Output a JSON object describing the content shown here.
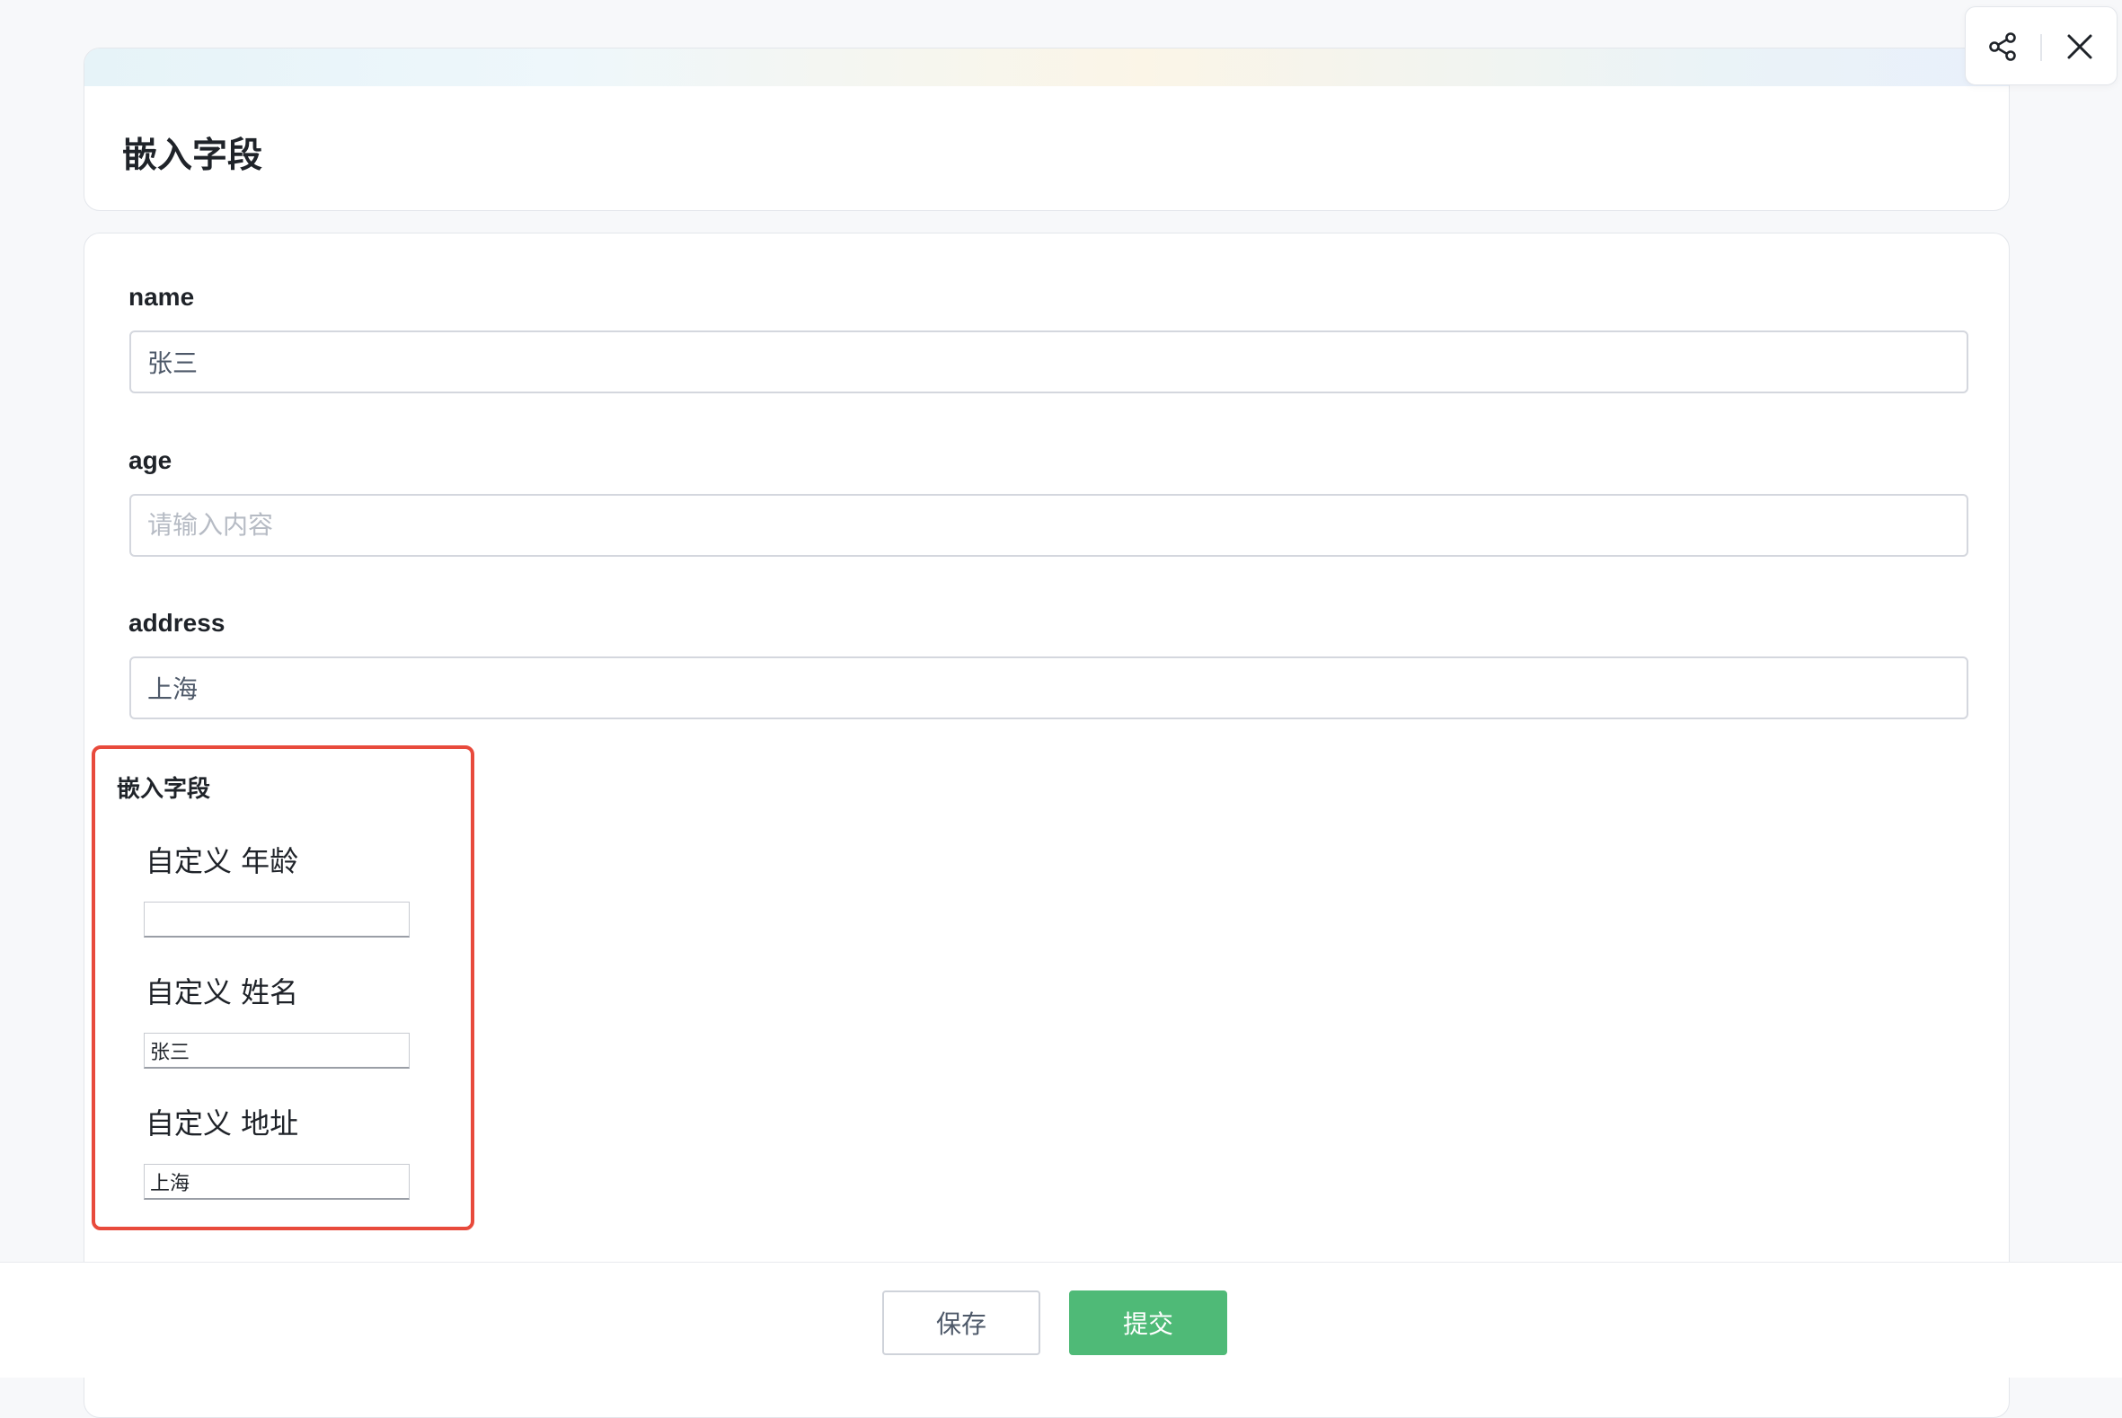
{
  "header": {
    "title": "嵌入字段"
  },
  "toolbar": {
    "share_icon": "share-icon",
    "close_icon": "close-icon"
  },
  "form": {
    "fields": [
      {
        "label": "name",
        "value": "张三",
        "placeholder": ""
      },
      {
        "label": "age",
        "value": "",
        "placeholder": "请输入内容"
      },
      {
        "label": "address",
        "value": "上海",
        "placeholder": ""
      }
    ],
    "embedded": {
      "title": "嵌入字段",
      "fields": [
        {
          "label": "自定义 年龄",
          "value": ""
        },
        {
          "label": "自定义 姓名",
          "value": "张三"
        },
        {
          "label": "自定义 地址",
          "value": "上海"
        }
      ]
    }
  },
  "footer": {
    "save_label": "保存",
    "submit_label": "提交"
  },
  "colors": {
    "accent_green": "#4fba77",
    "highlight_red": "#e84a3c"
  }
}
